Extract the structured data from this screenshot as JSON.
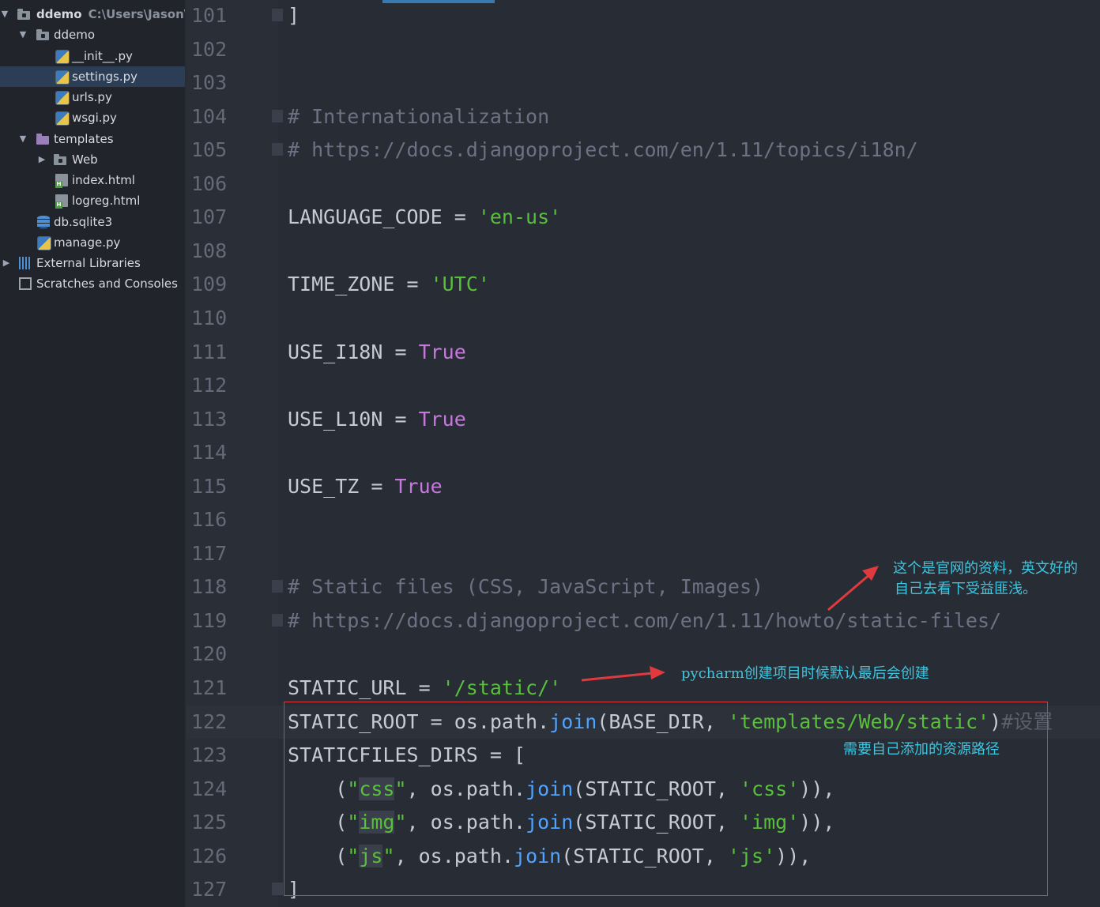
{
  "sidebar": {
    "items": [
      {
        "label": "ddemo",
        "path": "C:\\Users\\Jason\\dd",
        "arrow": "▼",
        "icon": "folder-icon"
      },
      {
        "label": "ddemo",
        "arrow": "▼",
        "icon": "folder-icon"
      },
      {
        "label": "__init__.py",
        "icon": "python-file-icon"
      },
      {
        "label": "settings.py",
        "icon": "python-file-icon",
        "selected": true
      },
      {
        "label": "urls.py",
        "icon": "python-file-icon"
      },
      {
        "label": "wsgi.py",
        "icon": "python-file-icon"
      },
      {
        "label": "templates",
        "arrow": "▼",
        "icon": "folder-icon"
      },
      {
        "label": "Web",
        "arrow": "▶",
        "icon": "folder-icon"
      },
      {
        "label": "index.html",
        "icon": "html-file-icon"
      },
      {
        "label": "logreg.html",
        "icon": "html-file-icon"
      },
      {
        "label": "db.sqlite3",
        "icon": "database-icon"
      },
      {
        "label": "manage.py",
        "icon": "python-file-icon"
      },
      {
        "label": "External Libraries",
        "arrow": "▶",
        "icon": "library-icon"
      },
      {
        "label": "Scratches and Consoles",
        "icon": "scratches-icon"
      }
    ]
  },
  "editor": {
    "file": "settings.py",
    "current_line": "122",
    "lines": [
      {
        "n": "101",
        "code": "]"
      },
      {
        "n": "102",
        "code": ""
      },
      {
        "n": "103",
        "code": ""
      },
      {
        "n": "104",
        "code": "# Internationalization"
      },
      {
        "n": "105",
        "code": "# https://docs.djangoproject.com/en/1.11/topics/i18n/"
      },
      {
        "n": "106",
        "code": ""
      },
      {
        "n": "107",
        "code": "LANGUAGE_CODE = 'en-us'"
      },
      {
        "n": "108",
        "code": ""
      },
      {
        "n": "109",
        "code": "TIME_ZONE = 'UTC'"
      },
      {
        "n": "110",
        "code": ""
      },
      {
        "n": "111",
        "code": "USE_I18N = True"
      },
      {
        "n": "112",
        "code": ""
      },
      {
        "n": "113",
        "code": "USE_L10N = True"
      },
      {
        "n": "114",
        "code": ""
      },
      {
        "n": "115",
        "code": "USE_TZ = True"
      },
      {
        "n": "116",
        "code": ""
      },
      {
        "n": "117",
        "code": ""
      },
      {
        "n": "118",
        "code": "# Static files (CSS, JavaScript, Images)"
      },
      {
        "n": "119",
        "code": "# https://docs.djangoproject.com/en/1.11/howto/static-files/"
      },
      {
        "n": "120",
        "code": ""
      },
      {
        "n": "121",
        "code": "STATIC_URL = '/static/'"
      },
      {
        "n": "122",
        "code": "STATIC_ROOT = os.path.join(BASE_DIR, 'templates/Web/static')#设置"
      },
      {
        "n": "123",
        "code": "STATICFILES_DIRS = ["
      },
      {
        "n": "124",
        "code": "    (\"css\", os.path.join(STATIC_ROOT, 'css')),"
      },
      {
        "n": "125",
        "code": "    (\"img\", os.path.join(STATIC_ROOT, 'img')),"
      },
      {
        "n": "126",
        "code": "    (\"js\", os.path.join(STATIC_ROOT, 'js')),"
      },
      {
        "n": "127",
        "code": "]"
      }
    ]
  },
  "annotations": {
    "official_docs_note_line1": "这个是官网的资料，英文好的",
    "official_docs_note_line2": "自己去看下受益匪浅。",
    "pycharm_note": "pycharm创建项目时候默认最后会创建",
    "resource_path_note": "需要自己添加的资源路径",
    "note_color": "#3ec6e0",
    "arrow_color": "#e0393e"
  },
  "colors": {
    "editor_bg": "#282c34",
    "sidebar_bg": "#21252b",
    "comment": "#6b7283",
    "string": "#58c03a",
    "keyword": "#c678dd",
    "function": "#4fa4ff"
  }
}
